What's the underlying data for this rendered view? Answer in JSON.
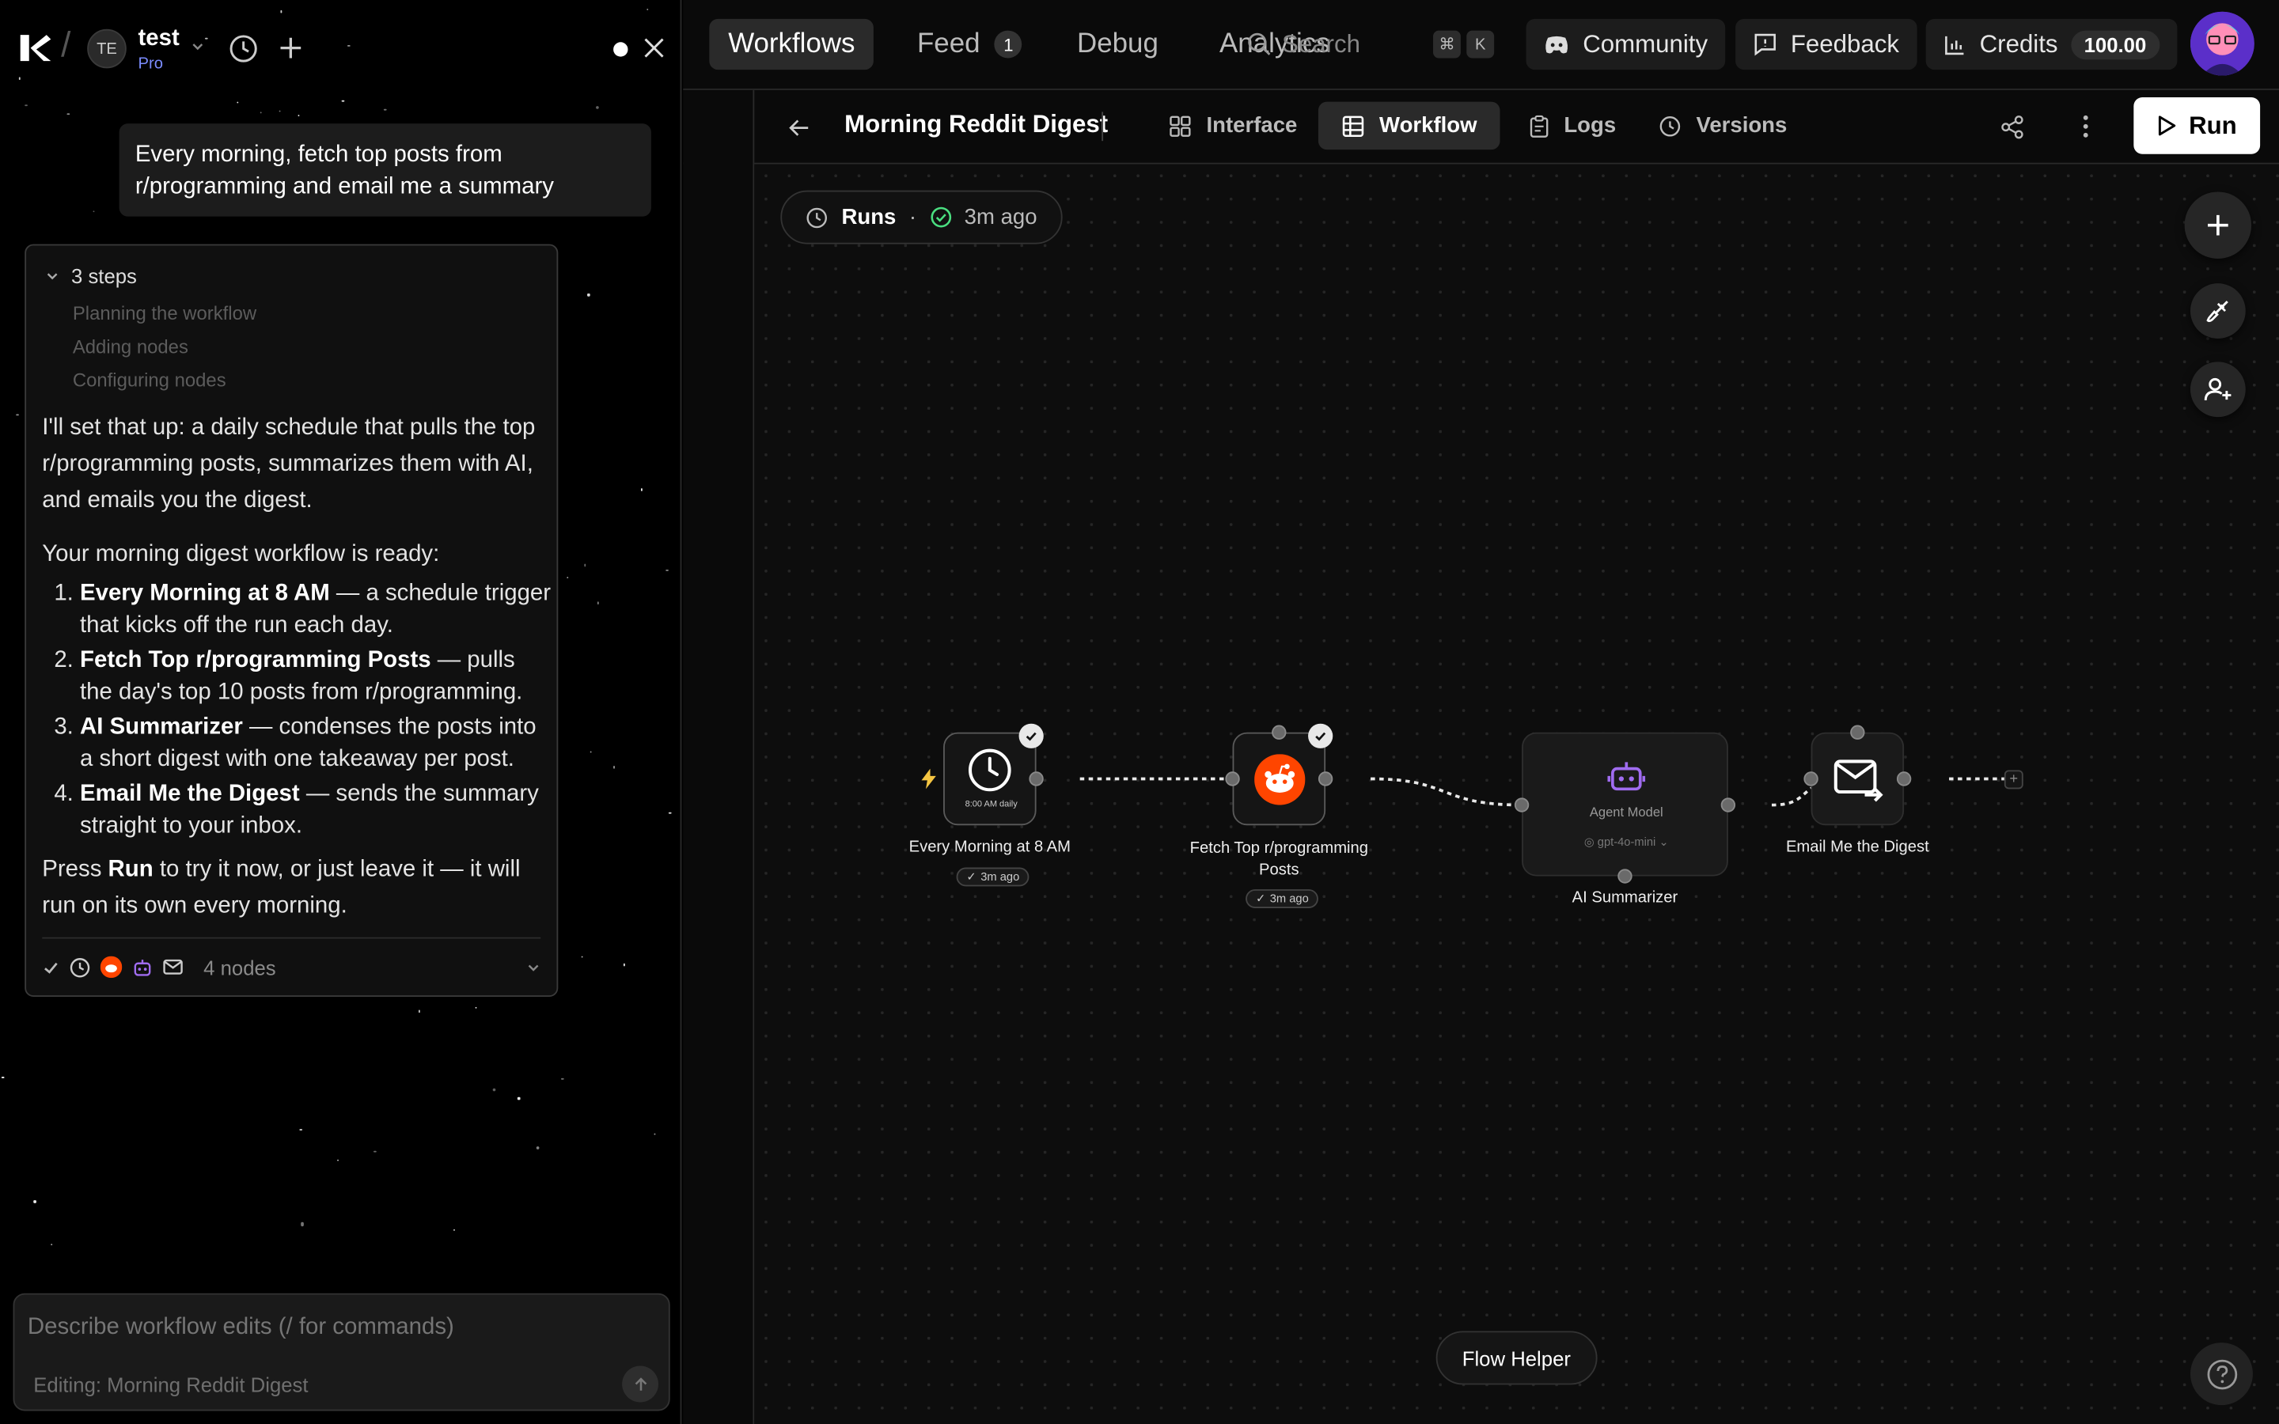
{
  "sidebar": {
    "workspace_initials": "TE",
    "workspace_name": "test",
    "workspace_plan": "Pro",
    "user_message": "Every morning, fetch top posts from r/programming and email me a summary",
    "steps_label": "3 steps",
    "steps": [
      "Planning the workflow",
      "Adding nodes",
      "Configuring nodes"
    ],
    "reply_intro": "I'll set that up: a daily schedule that pulls the top r/programming posts, summarizes them with AI, and emails you the digest.",
    "reply_ready": "Your morning digest workflow is ready:",
    "reply_items": [
      {
        "title": "Every Morning at 8 AM",
        "desc": " — a schedule trigger that kicks off the run each day."
      },
      {
        "title": "Fetch Top r/programming Posts",
        "desc": " — pulls the day's top 10 posts from r/programming."
      },
      {
        "title": "AI Summarizer",
        "desc": " — condenses the posts into a short digest with one takeaway per post."
      },
      {
        "title": "Email Me the Digest",
        "desc": " — sends the summary straight to your inbox."
      }
    ],
    "reply_outro_pre": "Press ",
    "reply_outro_bold": "Run",
    "reply_outro_post": " to try it now, or just leave it — it will run on its own every morning.",
    "nodes_count": "4 nodes",
    "composer_placeholder": "Describe workflow edits (/ for commands)",
    "composer_context": "Editing: Morning Reddit Digest"
  },
  "topnav": {
    "tabs": [
      {
        "label": "Workflows"
      },
      {
        "label": "Feed",
        "badge": "1"
      },
      {
        "label": "Debug"
      },
      {
        "label": "Analytics"
      }
    ],
    "search_placeholder": "Search",
    "search_kbd": [
      "⌘",
      "K"
    ],
    "community_label": "Community",
    "feedback_label": "Feedback",
    "credits_label": "Credits",
    "credits_value": "100.00"
  },
  "workflow": {
    "title": "Morning Reddit Digest",
    "tabs": [
      "Interface",
      "Workflow",
      "Logs",
      "Versions"
    ],
    "active_tab": "Workflow",
    "run_label": "Run",
    "runs_label": "Runs",
    "runs_time": "3m ago",
    "flow_helper": "Flow Helper",
    "nodes": [
      {
        "label": "Every Morning at 8 AM",
        "caption": "8:00 AM daily",
        "badge": "3m ago"
      },
      {
        "label": "Fetch Top r/programming Posts",
        "badge": "3m ago"
      },
      {
        "label": "AI Summarizer",
        "title": "Agent Model",
        "model": "gpt-4o-mini"
      },
      {
        "label": "Email Me the Digest"
      }
    ]
  },
  "colors": {
    "accent_plan": "#7b8cff",
    "reddit": "#ff4500",
    "agent_purple": "#a06cf0",
    "success": "#4ade80",
    "trigger": "#f5c542"
  }
}
